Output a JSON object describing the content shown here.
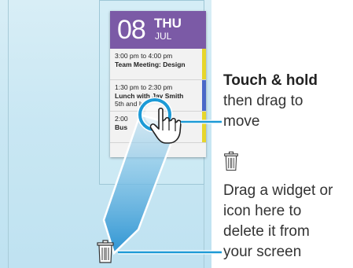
{
  "calendar_widget": {
    "day": "08",
    "weekday": "THU",
    "month": "JUL",
    "events": [
      {
        "time": "3:00 pm to 4:00 pm",
        "title": "Team Meeting: Design",
        "detail": "",
        "bar_color": "#e7d62c"
      },
      {
        "time": "1:30 pm to 2:30 pm",
        "title": "Lunch with Jay Smith",
        "detail": "5th and Ivy",
        "bar_color": "#4a69c8"
      },
      {
        "time": "2:00",
        "title": "Bus",
        "detail": "",
        "bar_color": "#e7d62c"
      }
    ]
  },
  "instructions": {
    "touch_hold": "Touch & hold",
    "then_drag": "then drag to",
    "move": "move",
    "drag_line1": "Drag a widget or",
    "drag_line2": "icon here to",
    "drag_line3": "delete it from",
    "drag_line4": "your screen"
  },
  "colors": {
    "calendar_header": "#7b5aa6",
    "arrow_fill": "#4aa6da",
    "callout_ring": "#1c9ad6",
    "screen_bg": "#c9e7f3"
  },
  "icons": {
    "trash": "trash-icon",
    "hand": "hand-pointer-icon"
  }
}
